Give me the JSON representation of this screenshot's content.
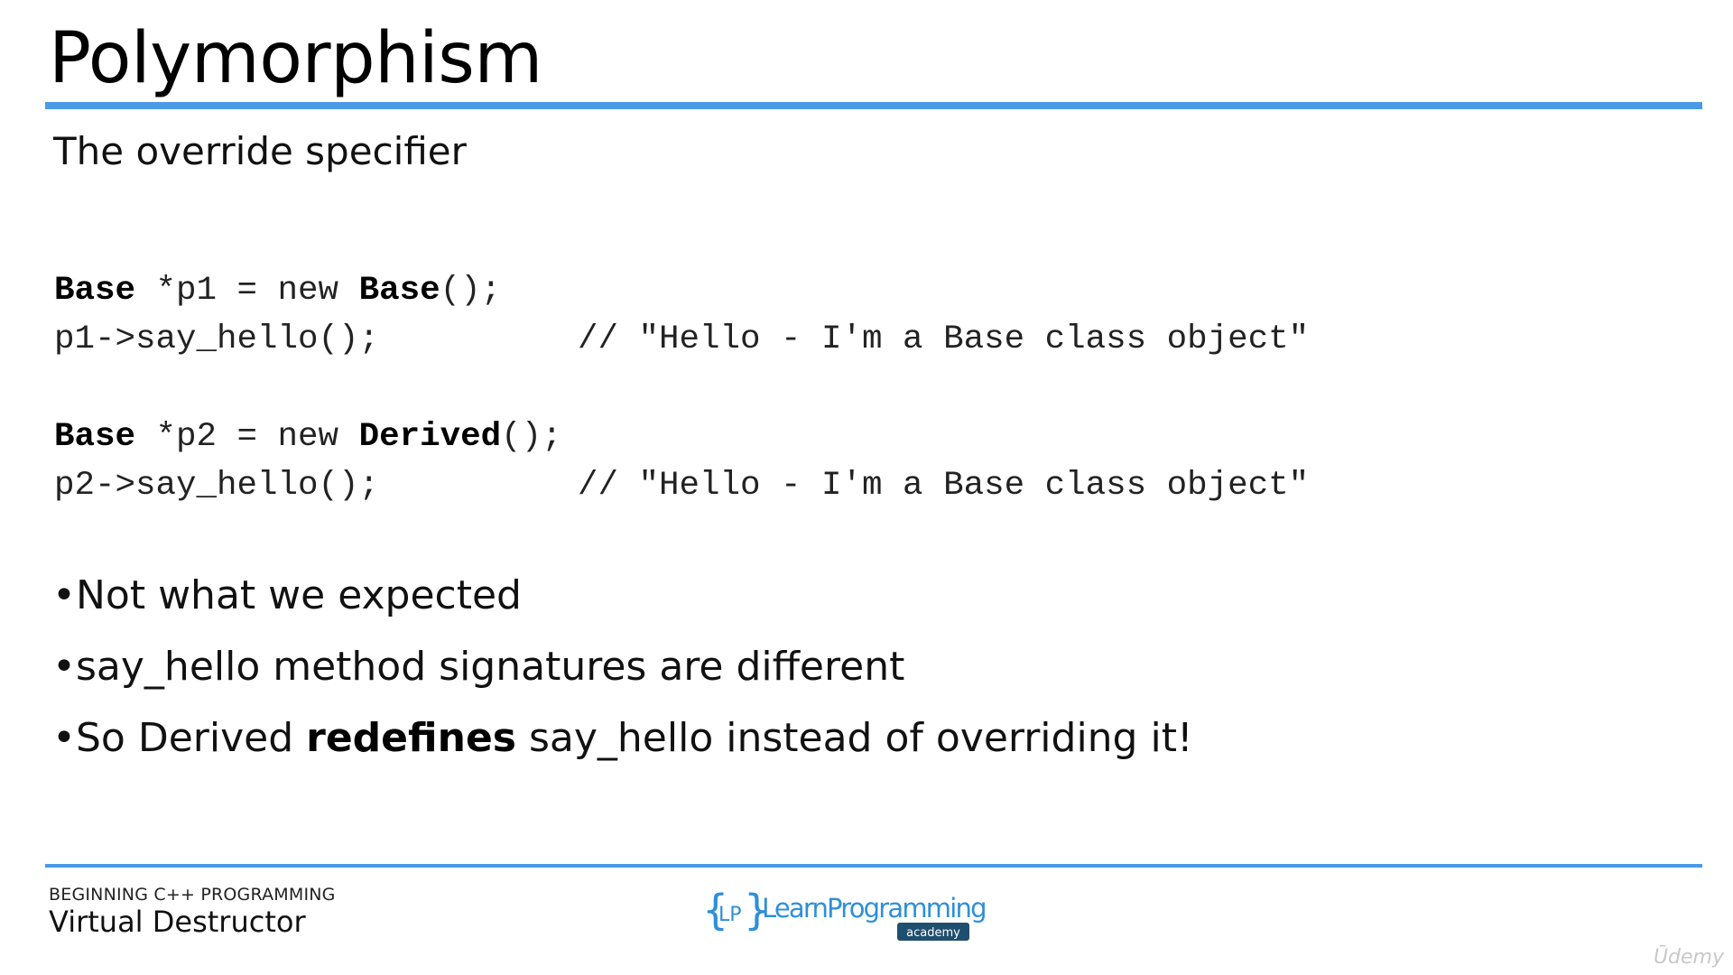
{
  "slide": {
    "title": "Polymorphism",
    "subtitle": "The override specifier"
  },
  "code": {
    "line1": {
      "kw1": "Base",
      "rest1": " *p1 = new ",
      "kw2": "Base",
      "rest2": "();"
    },
    "line2": {
      "text": "p1->say_hello();",
      "comment": "// \"Hello - I'm a Base class object\""
    },
    "line3": {
      "kw1": "Base",
      "rest1": " *p2 = new ",
      "kw2": "Derived",
      "rest2": "();"
    },
    "line4": {
      "text": "p2->say_hello();",
      "comment": "// \"Hello - I'm a Base class object\""
    }
  },
  "bullets": {
    "b1": "Not what we expected",
    "b2": "say_hello method signatures are different",
    "b3_pre": "So Derived ",
    "b3_bold": "redefines",
    "b3_post": " say_hello instead of overriding it!"
  },
  "footer": {
    "course": "BEGINNING C++ PROGRAMMING",
    "lecture": "Virtual Destructor",
    "logo_brace_text": "LP",
    "logo_name": "LearnProgramming",
    "logo_sub": "academy",
    "watermark": "Ūdemy"
  },
  "colors": {
    "accent": "#4a9ae6",
    "logo_blue": "#2f8fd8",
    "logo_badge": "#1f4f6e"
  }
}
